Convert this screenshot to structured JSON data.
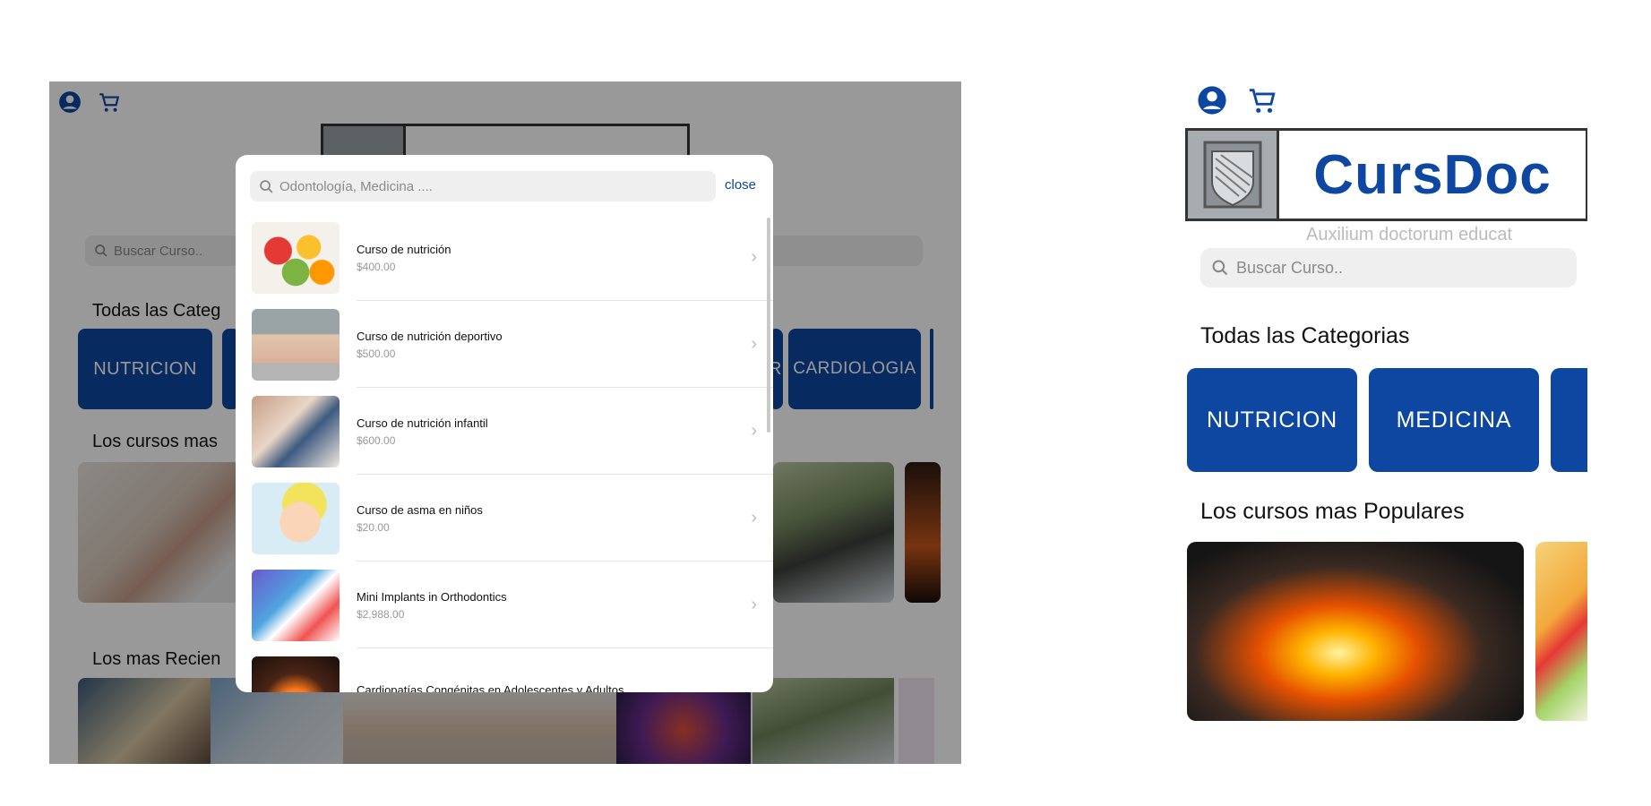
{
  "tablet": {
    "header": {
      "user_icon": "user-circle-icon",
      "cart_icon": "cart-icon"
    },
    "search": {
      "placeholder": "Buscar Curso.."
    },
    "sections": {
      "categories_title": "Todas las Categ",
      "popular_title": "Los cursos mas",
      "recent_title": "Los mas Recien"
    },
    "categories": [
      {
        "label": "NUTRICION"
      },
      {
        "label": "R"
      },
      {
        "label": "CARDIOLOGIA"
      }
    ]
  },
  "search_modal": {
    "search": {
      "placeholder": "Odontología, Medicina ....",
      "icon": "search-icon"
    },
    "close_label": "close",
    "results": [
      {
        "title": "Curso de nutrición",
        "price": "$400.00"
      },
      {
        "title": "Curso de nutrición deportivo",
        "price": "$500.00"
      },
      {
        "title": "Curso de nutrición infantil",
        "price": "$600.00"
      },
      {
        "title": "Curso de asma en niños",
        "price": "$20.00"
      },
      {
        "title": "Mini Implants in Orthodontics",
        "price": "$2,988.00"
      },
      {
        "title": "Cardiopatías Congénitas en Adolescentes y Adultos",
        "price": ""
      }
    ]
  },
  "phone": {
    "header": {
      "user_icon": "user-circle-icon",
      "cart_icon": "cart-icon"
    },
    "brand": {
      "name": "CursDoc",
      "motto": "Auxilium doctorum educat"
    },
    "search": {
      "placeholder": "Buscar Curso.."
    },
    "sections": {
      "categories_title": "Todas las Categorias",
      "popular_title": "Los cursos mas Populares"
    },
    "categories": [
      {
        "label": "NUTRICION"
      },
      {
        "label": "MEDICINA"
      }
    ]
  },
  "colors": {
    "brand_blue": "#0d47a1",
    "overlay": "rgba(0,0,0,0.4)"
  }
}
